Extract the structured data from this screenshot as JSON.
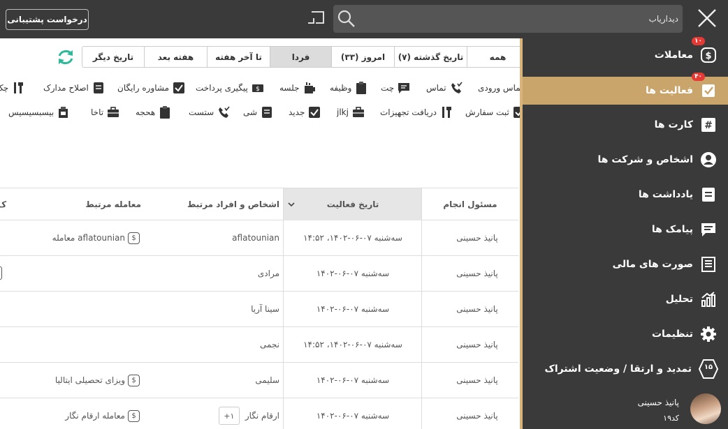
{
  "topbar": {
    "support_button": "درخواست پشتیبانی",
    "search_value": "دیداریاب"
  },
  "sidebar": {
    "items": [
      {
        "label": "معاملات",
        "icon": "dollar-icon",
        "badge": "۱۰"
      },
      {
        "label": "فعالیت ها",
        "icon": "check-icon",
        "badge": "۴۰"
      },
      {
        "label": "کارت ها",
        "icon": "hash-icon"
      },
      {
        "label": "اشخاص و شرکت ها",
        "icon": "person-icon"
      },
      {
        "label": "یادداشت ها",
        "icon": "note-icon"
      },
      {
        "label": "پیامک ها",
        "icon": "sms-icon"
      },
      {
        "label": "صورت های مالی",
        "icon": "invoice-icon"
      },
      {
        "label": "تحلیل",
        "icon": "chart-icon"
      },
      {
        "label": "تنظیمات",
        "icon": "gear-icon"
      },
      {
        "label": "تمدید و ارتقا / وضعیت اشتراک",
        "icon": "subscription-icon",
        "icon_text": "۱۵"
      }
    ],
    "user": {
      "name": "پانیذ حسینی",
      "code": "کد۱۹"
    }
  },
  "date_tabs": [
    {
      "label": "همه"
    },
    {
      "label": "تاریخ گذشته (۷)"
    },
    {
      "label": "امروز (۳۳)"
    },
    {
      "label": "فردا",
      "active": true
    },
    {
      "label": "تا آخر هفته"
    },
    {
      "label": "هفته بعد"
    },
    {
      "label": "تاریخ دیگر"
    }
  ],
  "activity_types_row1": [
    {
      "label": "تماس ورودی",
      "icon": "phone-icon"
    },
    {
      "label": "تماس",
      "icon": "phone-icon"
    },
    {
      "label": "چت",
      "icon": "chat-icon"
    },
    {
      "label": "وظیفه",
      "icon": "clipboard-icon"
    },
    {
      "label": "جلسه",
      "icon": "meeting-icon"
    },
    {
      "label": "پیگیری پرداخت",
      "icon": "payment-icon"
    },
    {
      "label": "مشاوره رایگان",
      "icon": "check-icon"
    },
    {
      "label": "اصلاح مدارک",
      "icon": "document-icon"
    },
    {
      "label": "چک",
      "icon": "tools-icon"
    }
  ],
  "activity_types_row2": [
    {
      "label": "ثبت سفارش",
      "icon": "check-icon"
    },
    {
      "label": "دریافت تجهیزات",
      "icon": "tools-icon"
    },
    {
      "label": "jlkj",
      "icon": "briefcase-icon"
    },
    {
      "label": "جدید",
      "icon": "check-icon"
    },
    {
      "label": "شی",
      "icon": "document-icon"
    },
    {
      "label": "ستست",
      "icon": "phone-icon"
    },
    {
      "label": "هحجه",
      "icon": "clipboard-icon"
    },
    {
      "label": "تاخا",
      "icon": "briefcase-icon"
    },
    {
      "label": "بیسبسیسیس",
      "icon": "meeting-icon"
    }
  ],
  "table": {
    "headers": {
      "responsible": "مسئول انجام",
      "date": "تاریخ فعالیت",
      "people": "اشخاص و افراد مرتبط",
      "deal": "معامله مرتبط",
      "cut": "ک"
    },
    "rows": [
      {
        "responsible": "پانیذ حسینی",
        "date": "سه‌شنبه ۰۷-۰۶-۱۴۰۲، ۱۴:۵۲",
        "person": "aflatounian",
        "deal": "معامله aflatounian"
      },
      {
        "responsible": "پانیذ حسینی",
        "date": "سه‌شنبه ۰۷-۰۶-۱۴۰۲",
        "person": "مرادی",
        "deal": ""
      },
      {
        "responsible": "پانیذ حسینی",
        "date": "سه‌شنبه ۰۷-۰۶-۱۴۰۲",
        "person": "سینا آریا",
        "deal": ""
      },
      {
        "responsible": "پانیذ حسینی",
        "date": "سه‌شنبه ۰۷-۰۶-۱۴۰۲، ۱۴:۵۲",
        "person": "نجمی",
        "deal": ""
      },
      {
        "responsible": "پانیذ حسینی",
        "date": "سه‌شنبه ۰۷-۰۶-۱۴۰۲",
        "person": "سلیمی",
        "deal": "ویزای تحصیلی ایتالیا"
      },
      {
        "responsible": "پانیذ حسینی",
        "date": "سه‌شنبه ۰۷-۰۶-۱۴۰۲",
        "person": "ارقام نگار",
        "plus": "+۱",
        "deal": "معامله ارقام نگار"
      }
    ]
  }
}
